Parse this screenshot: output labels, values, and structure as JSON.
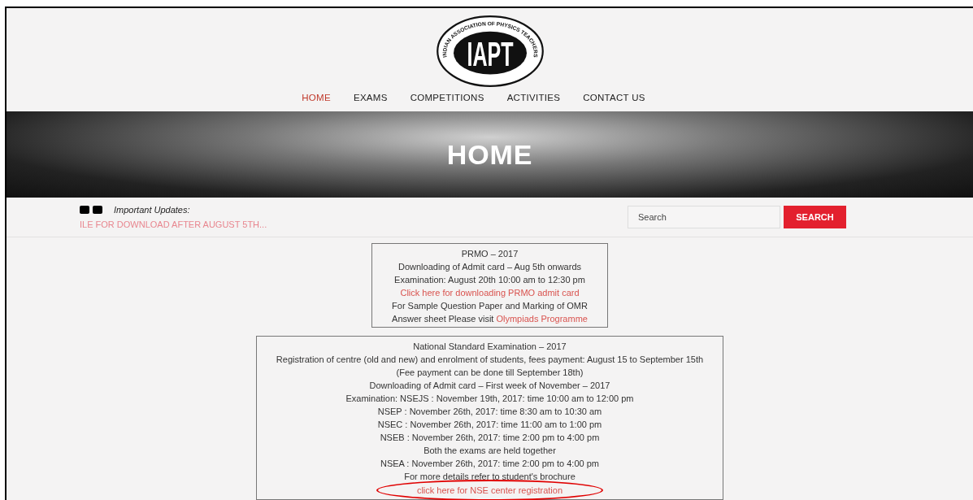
{
  "logo": {
    "letters": "IAPT",
    "ring_text": "INDIAN ASSOCIATION OF PHYSICS TEACHERS"
  },
  "nav": [
    {
      "label": "HOME",
      "selected": true
    },
    {
      "label": "EXAMS",
      "selected": false
    },
    {
      "label": "COMPETITIONS",
      "selected": false
    },
    {
      "label": "ACTIVITIES",
      "selected": false
    },
    {
      "label": "CONTACT US",
      "selected": false
    }
  ],
  "banner": {
    "title": "HOME"
  },
  "updates": {
    "label": "Important Updates:",
    "ticker": "ILE FOR DOWNLOAD AFTER AUGUST 5TH..."
  },
  "search": {
    "placeholder": "Search",
    "button": "SEARCH"
  },
  "boxes": [
    {
      "lines": [
        {
          "kind": "text",
          "text": "PRMO – 2017"
        },
        {
          "kind": "text",
          "text": "Downloading of Admit card – Aug 5th onwards"
        },
        {
          "kind": "text",
          "text": "Examination: August 20th 10:00 am to 12:30 pm"
        },
        {
          "kind": "link",
          "text": "Click here for downloading PRMO admit card"
        },
        {
          "kind": "text",
          "text": "For Sample Question Paper and Marking of OMR"
        },
        {
          "kind": "mixed",
          "text": "Answer sheet Please visit ",
          "link": "Olympiads Programme"
        }
      ]
    },
    {
      "lines": [
        {
          "kind": "text",
          "text": "National Standard Examination – 2017"
        },
        {
          "kind": "text",
          "text": "Registration of centre (old and new) and enrolment of students, fees payment: August 15 to September 15th"
        },
        {
          "kind": "text",
          "text": "(Fee payment can be done till September 18th)"
        },
        {
          "kind": "text",
          "text": "Downloading of Admit card – First week of November – 2017"
        },
        {
          "kind": "text",
          "text": "Examination: NSEJS : November 19th, 2017: time 10:00 am to 12:00 pm"
        },
        {
          "kind": "text",
          "text": "NSEP : November 26th, 2017: time 8:30 am to 10:30 am"
        },
        {
          "kind": "text",
          "text": "NSEC : November 26th, 2017: time 11:00 am to 1:00 pm"
        },
        {
          "kind": "text",
          "text": "NSEB : November 26th, 2017: time 2:00 pm to 4:00 pm"
        },
        {
          "kind": "text",
          "text": "Both the exams are held together"
        },
        {
          "kind": "text",
          "text": "NSEA : November 26th, 2017: time 2:00 pm to 4:00 pm"
        },
        {
          "kind": "text",
          "text": "For more details refer to student's brochure"
        },
        {
          "kind": "link",
          "text": "click here for NSE center registration",
          "circled": true
        }
      ]
    }
  ]
}
